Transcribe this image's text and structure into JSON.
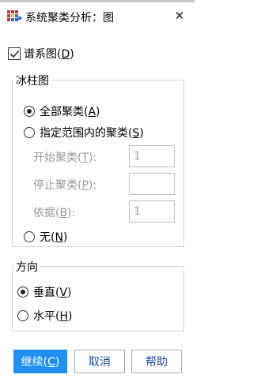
{
  "window": {
    "title": "系统聚类分析：图",
    "close_symbol": "✕"
  },
  "dendrogram": {
    "label_pre": "谱系图(",
    "mnemonic": "D",
    "label_post": ")",
    "checked": true
  },
  "icicle": {
    "group_title": "冰柱图",
    "options": [
      {
        "pre": "全部聚类(",
        "key": "A",
        "post": ")",
        "selected": true
      },
      {
        "pre": "指定范围内的聚类(",
        "key": "S",
        "post": ")",
        "selected": false
      },
      {
        "pre": "无(",
        "key": "N",
        "post": ")",
        "selected": false
      }
    ],
    "fields": [
      {
        "pre": "开始聚类(",
        "key": "T",
        "post": "):",
        "value": "1"
      },
      {
        "pre": "停止聚类(",
        "key": "P",
        "post": "):",
        "value": ""
      },
      {
        "pre": "依据(",
        "key": "B",
        "post": "):",
        "value": "1"
      }
    ]
  },
  "orientation": {
    "group_title": "方向",
    "options": [
      {
        "pre": "垂直(",
        "key": "V",
        "post": ")",
        "selected": true
      },
      {
        "pre": "水平(",
        "key": "H",
        "post": ")",
        "selected": false
      }
    ]
  },
  "buttons": {
    "continue": {
      "pre": "继续(",
      "key": "C",
      "post": ")"
    },
    "cancel": "取消",
    "help": "帮助"
  },
  "colors": {
    "primary_button": "#1f8ff0",
    "button_text": "#1e4d9a",
    "disabled_text": "#9a9a9a"
  }
}
